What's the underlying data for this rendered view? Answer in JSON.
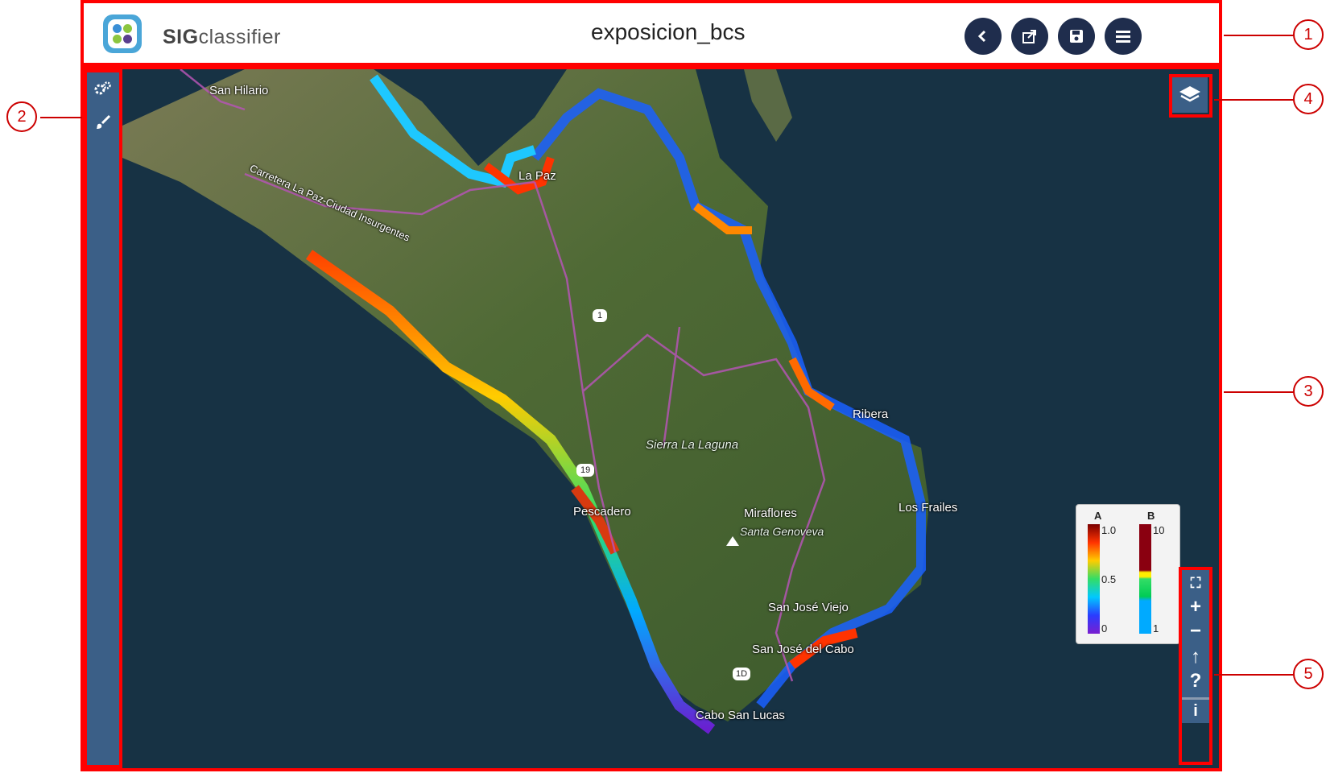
{
  "app": {
    "brand_bold": "SIG",
    "brand_rest": "classifier",
    "map_title": "exposicion_bcs"
  },
  "header_buttons": [
    {
      "icon": "back-icon"
    },
    {
      "icon": "share-icon"
    },
    {
      "icon": "save-icon"
    },
    {
      "icon": "menu-icon"
    }
  ],
  "sidebar": [
    {
      "icon": "settings-icon"
    },
    {
      "icon": "brush-icon"
    }
  ],
  "places": {
    "san_hilario": "San Hilario",
    "carretera": "Carretera La Paz-Ciudad Insurgentes",
    "la_paz": "La Paz",
    "sierra": "Sierra La Laguna",
    "pescadero": "Pescadero",
    "miraflores": "Miraflores",
    "santa_genoveva": "Santa Genoveva",
    "los_frailes": "Los Frailes",
    "san_jose_viejo": "San José Viejo",
    "san_jose_cabo": "San José del Cabo",
    "ribera": "Ribera",
    "cabo": "Cabo San Lucas"
  },
  "road_shields": [
    "1",
    "19",
    "1D"
  ],
  "legend": {
    "a": {
      "label": "A",
      "max": "1.0",
      "mid": "0.5",
      "min": "0"
    },
    "b": {
      "label": "B",
      "max": "10",
      "min": "1"
    }
  },
  "map_controls": [
    {
      "icon": "fullscreen-icon",
      "glyph": "⛶"
    },
    {
      "icon": "zoom-in-icon",
      "glyph": "+"
    },
    {
      "icon": "zoom-out-icon",
      "glyph": "−"
    },
    {
      "icon": "north-arrow-icon",
      "glyph": "↑"
    },
    {
      "icon": "help-icon",
      "glyph": "?"
    },
    {
      "icon": "info-icon",
      "glyph": "i"
    }
  ],
  "callouts": [
    "1",
    "2",
    "3",
    "4",
    "5"
  ],
  "colors": {
    "accent": "#ff0000",
    "sidebar": "#3b5f87",
    "button": "#1f2d4d",
    "water": "#173244"
  }
}
